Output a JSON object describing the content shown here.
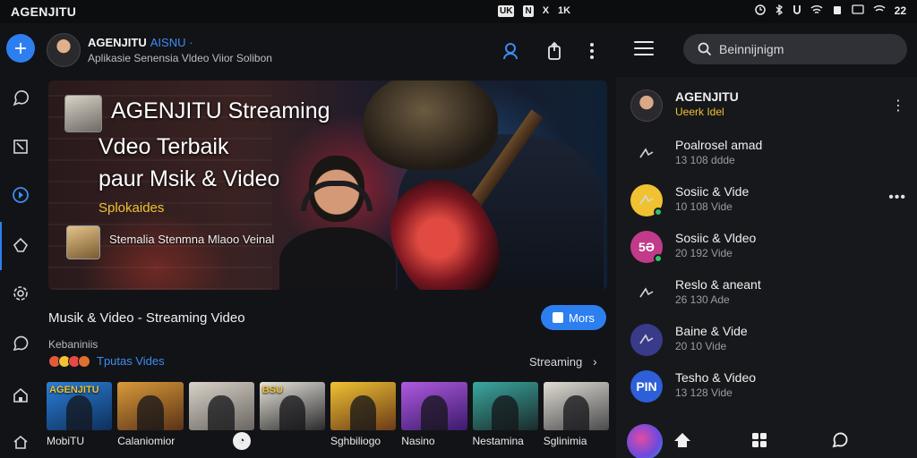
{
  "status_bar": {
    "app_title": "AGENJITU",
    "mid_icons": [
      "UK",
      "N",
      "X",
      "1K"
    ],
    "right_icons": [
      "alarm-icon",
      "bluetooth-icon",
      "u-icon",
      "wifi-icon",
      "battery-icon",
      "cast-icon",
      "wifi-icon"
    ],
    "right_text": "22"
  },
  "left_header": {
    "name": "AGENJITU",
    "name_accent": "AISNU ·",
    "subtitle": "Aplikasie Senensia Vldeo Viior Solibon"
  },
  "hero": {
    "title_line1": "AGENJITU Streaming",
    "title_line2": "Vdeo Terbaik",
    "title_line3": "paur Msik & Video",
    "tag": "Splokaides",
    "caption": "Stemalia  Stenmna Mlaoo Veinal"
  },
  "section": {
    "title": "Musik & Video - Streaming Video",
    "more_label": "Mors",
    "category_label": "Kebaniniis",
    "chips_label": "Tputas Vides",
    "streaming_label": "Streaming",
    "chip_colors": [
      "#e05a3a",
      "#f0c232",
      "#e84848",
      "#e07030"
    ]
  },
  "thumbnails": [
    {
      "label": "MobiTU",
      "text": "AGENJITU",
      "colors": [
        "#2b7fd8",
        "#0e2f5a"
      ]
    },
    {
      "label": "Calaniomior",
      "text": "",
      "colors": [
        "#d89a3a",
        "#5a3216"
      ]
    },
    {
      "label": "",
      "text": "",
      "colors": [
        "#d8d2c8",
        "#6a6560"
      ]
    },
    {
      "label": "",
      "text": "BSU",
      "colors": [
        "#e8e4dc",
        "#2a2a2a"
      ]
    },
    {
      "label": "Sghbiliogo",
      "text": "",
      "colors": [
        "#f0c232",
        "#6a3a18"
      ]
    },
    {
      "label": "Nasino",
      "text": "",
      "colors": [
        "#b05ae0",
        "#3a1a6a"
      ]
    },
    {
      "label": "Nestamina",
      "text": "",
      "colors": [
        "#3aa8a0",
        "#1a2a2a"
      ]
    },
    {
      "label": "Sglinimia",
      "text": "",
      "colors": [
        "#e0dcd4",
        "#4a4a4a"
      ]
    }
  ],
  "right_panel": {
    "search_placeholder": "Beinnijnigm",
    "profile": {
      "name": "AGENJITU",
      "subtitle": "Ueerk Idel"
    },
    "items": [
      {
        "name": "Poalrosel amad",
        "meta": "13 108 ddde",
        "avatar_text": "",
        "avatar_color": "#17181b",
        "online": false,
        "more": false
      },
      {
        "name": "Sosiic & Vide",
        "meta": "10 108 Vide",
        "avatar_text": "",
        "avatar_color": "#f0c232",
        "online": true,
        "more": true
      },
      {
        "name": "Sosiic & Vldeo",
        "meta": "20 192 Vide",
        "avatar_text": "5Ə",
        "avatar_color": "#c23a8a",
        "online": true,
        "more": false
      },
      {
        "name": "Reslo & aneant",
        "meta": "26 130 Ade",
        "avatar_text": "",
        "avatar_color": "#17181b",
        "online": false,
        "more": false
      },
      {
        "name": "Baine & Vide",
        "meta": "20 10 Vide",
        "avatar_text": "",
        "avatar_color": "#3a3a8a",
        "online": false,
        "more": false
      },
      {
        "name": "Tesho & Video",
        "meta": "13 128 Vide",
        "avatar_text": "PIN",
        "avatar_color": "#2d5fd8",
        "online": false,
        "more": false
      }
    ]
  },
  "colors": {
    "accent": "#2d7ff0",
    "accent_text": "#3d8cf5",
    "highlight": "#f0c232",
    "background": "#121316",
    "panel": "#17181b"
  }
}
